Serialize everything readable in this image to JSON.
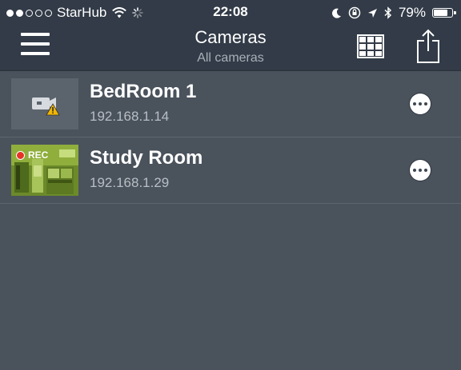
{
  "status_bar": {
    "carrier": "StarHub",
    "time": "22:08",
    "battery_text": "79%",
    "battery_level": 0.79,
    "signal_bars_filled": 2,
    "signal_bars_total": 5
  },
  "nav": {
    "title": "Cameras",
    "subtitle": "All cameras"
  },
  "cameras": [
    {
      "name": "BedRoom 1",
      "ip": "192.168.1.14",
      "thumbnail": "camera-warning-icon"
    },
    {
      "name": "Study Room",
      "ip": "192.168.1.29",
      "thumbnail": "live-preview",
      "rec_label": "REC"
    }
  ],
  "colors": {
    "nav_bg": "#323b47",
    "list_bg": "#4a525c",
    "warning": "#f2b705",
    "rec": "#e53325"
  }
}
